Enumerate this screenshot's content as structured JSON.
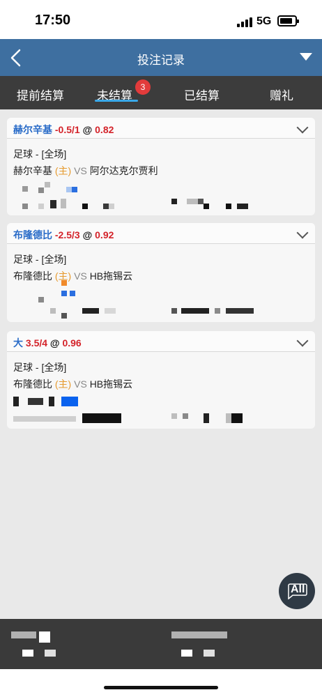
{
  "status_bar": {
    "time": "17:50",
    "network": "5G"
  },
  "nav": {
    "title": "投注记录",
    "back_icon": "back-arrow-icon",
    "menu_icon": "dropdown-triangle-icon"
  },
  "tabs": [
    {
      "label": "提前结算",
      "active": false
    },
    {
      "label": "未结算",
      "active": true,
      "badge": "3"
    },
    {
      "label": "已结算",
      "active": false
    },
    {
      "label": "赠礼",
      "active": false
    }
  ],
  "bets": [
    {
      "selection": "赫尔辛基",
      "handicap": "-0.5/1",
      "at": "@",
      "odds": "0.82",
      "sport_market": "足球 - [全场]",
      "home_team": "赫尔辛基",
      "home_tag": "(主)",
      "vs": "VS",
      "away_team": "阿尔达克尔贾利"
    },
    {
      "selection": "布隆德比",
      "handicap": "-2.5/3",
      "at": "@",
      "odds": "0.92",
      "sport_market": "足球 - [全场]",
      "home_team": "布隆德比",
      "home_tag": "(主)",
      "vs": "VS",
      "away_team": "HB拖锡云"
    },
    {
      "selection": "大",
      "handicap": "3.5/4",
      "at": "@",
      "odds": "0.96",
      "sport_market": "足球 - [全场]",
      "home_team": "布隆德比",
      "home_tag": "(主)",
      "vs": "VS",
      "away_team": "HB拖锡云"
    }
  ],
  "fab": {
    "label": "All"
  },
  "colors": {
    "nav": "#3e6fa0",
    "tabs": "#3c3c3c",
    "accent_blue": "#2a6cc8",
    "odds_red": "#d4232a",
    "home_orange": "#e69a2e"
  }
}
